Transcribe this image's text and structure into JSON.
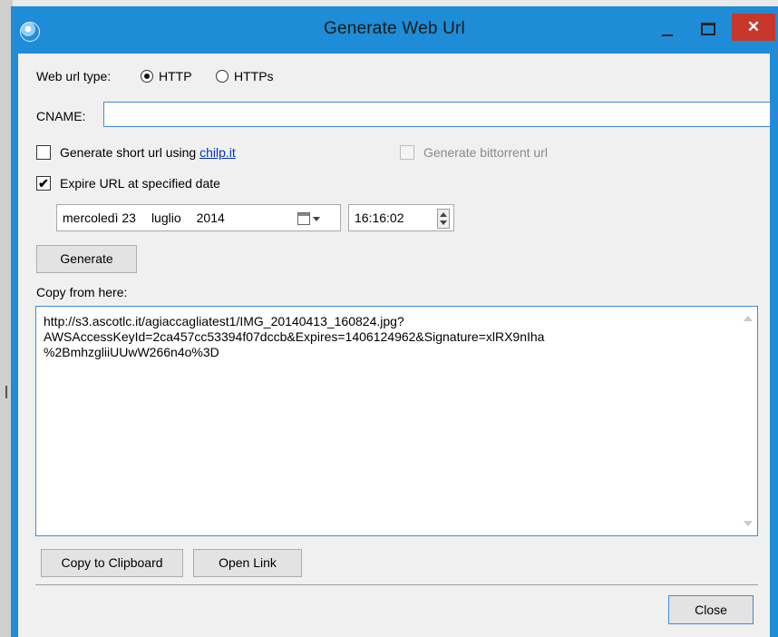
{
  "window": {
    "title": "Generate Web Url",
    "close_glyph": "✕"
  },
  "form": {
    "url_type_label": "Web url type:",
    "url_types": [
      {
        "label": "HTTP",
        "selected": true
      },
      {
        "label": "HTTPs",
        "selected": false
      }
    ],
    "cname_label": "CNAME:",
    "cname_value": "",
    "short_url": {
      "checked": false,
      "label": "Generate short url using",
      "link": "chilp.it"
    },
    "bittorrent": {
      "checked": false,
      "enabled": false,
      "label": "Generate bittorrent url"
    },
    "expire": {
      "checked": true,
      "label": "Expire URL at specified date",
      "check_glyph": "✔"
    },
    "date": {
      "weekday_day": "mercoledì 23",
      "month": "luglio",
      "year": "2014"
    },
    "time": "16:16:02",
    "generate_label": "Generate",
    "copy_label": "Copy from here:",
    "url_output": "http://s3.ascotlc.it/agiaccagliatest1/IMG_20140413_160824.jpg?\nAWSAccessKeyId=2ca457cc53394f07dccb&Expires=1406124962&Signature=xlRX9nIha\n%2BmhzgliiUUwW266n4o%3D"
  },
  "buttons": {
    "copy_clipboard": "Copy to Clipboard",
    "open_link": "Open Link",
    "close": "Close"
  },
  "colors": {
    "titlebar": "#1e8cd6",
    "close_button": "#c7362b",
    "focus_border": "#3d8bd9",
    "link": "#0033cc"
  },
  "icons": [
    "app-globe-icon",
    "minimize-icon",
    "maximize-icon",
    "close-icon",
    "calendar-icon",
    "dropdown-arrow-icon",
    "spin-up-icon",
    "spin-down-icon",
    "scroll-up-icon",
    "scroll-down-icon"
  ]
}
